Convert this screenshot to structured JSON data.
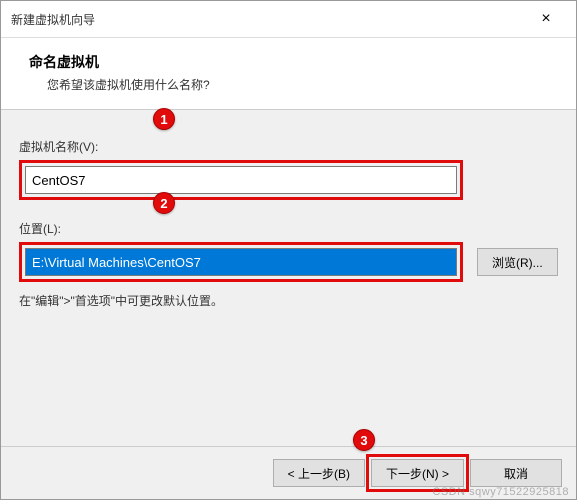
{
  "window": {
    "title": "新建虚拟机向导",
    "close_icon": "×"
  },
  "header": {
    "title": "命名虚拟机",
    "subtitle": "您希望该虚拟机使用什么名称?"
  },
  "fields": {
    "name_label": "虚拟机名称(V):",
    "name_value": "CentOS7",
    "location_label": "位置(L):",
    "location_value": "E:\\Virtual Machines\\CentOS7",
    "browse_label": "浏览(R)...",
    "hint": "在\"编辑\">\"首选项\"中可更改默认位置。"
  },
  "footer": {
    "back_label": "< 上一步(B)",
    "next_label": "下一步(N) >",
    "cancel_label": "取消"
  },
  "callouts": {
    "c1": "1",
    "c2": "2",
    "c3": "3"
  },
  "watermark": "CSDN sqwy71522925818"
}
